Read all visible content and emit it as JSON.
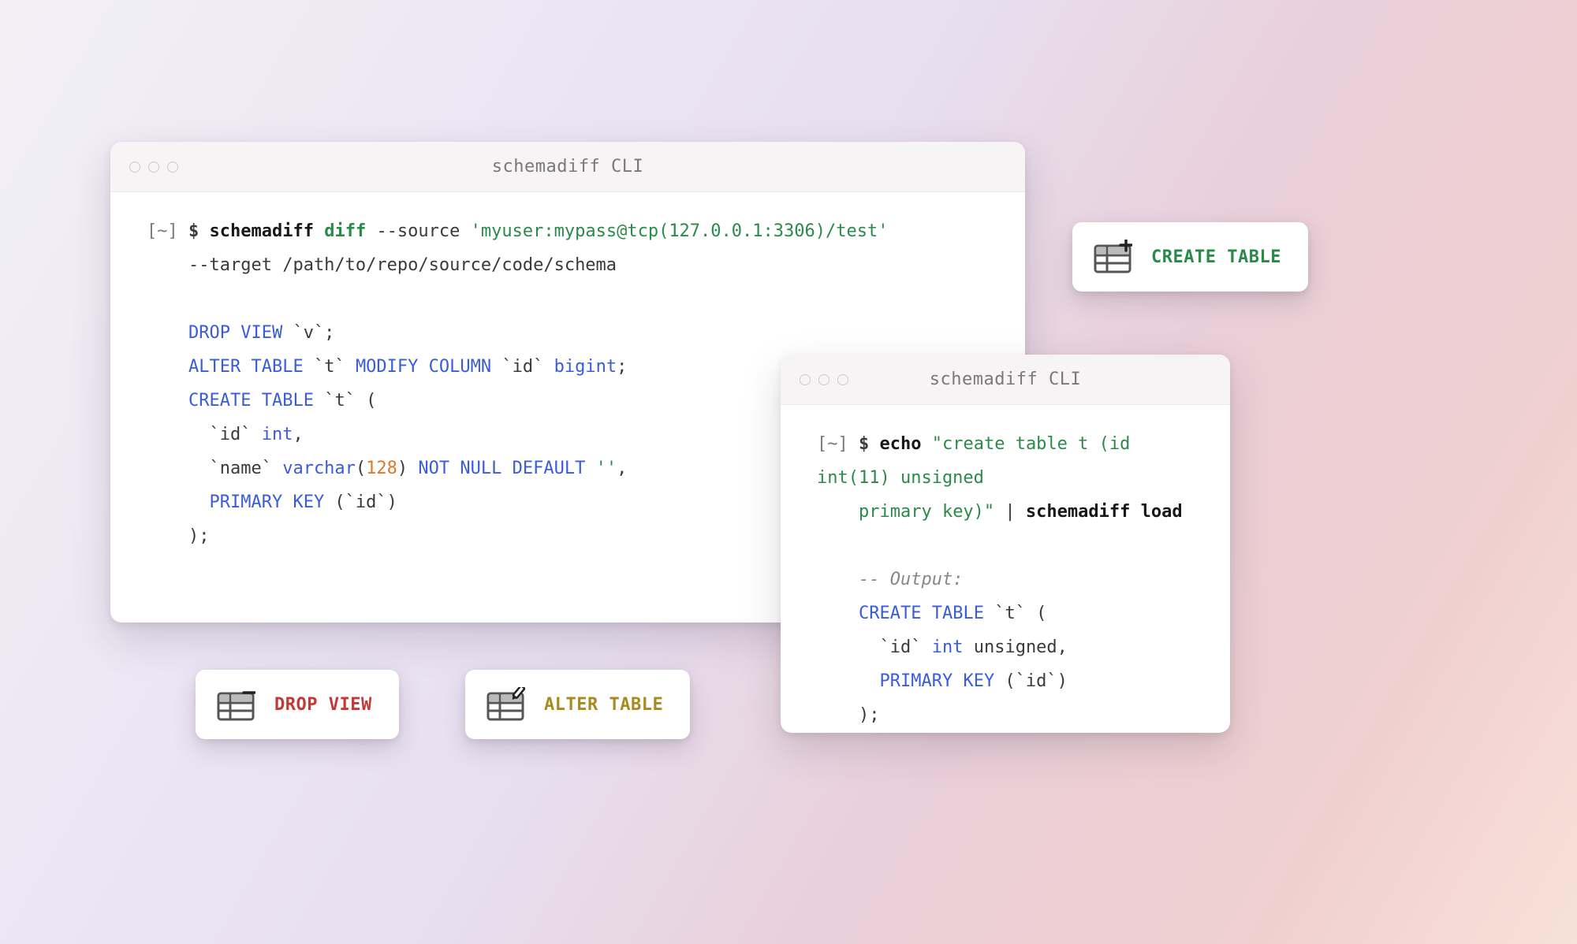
{
  "terminal_left": {
    "title": "schemadiff CLI",
    "prompt": "[~]",
    "dollar": "$",
    "cmd": "schemadiff",
    "subcmd": "diff",
    "flag_source": "--source",
    "source_val": "'myuser:mypass@tcp(127.0.0.1:3306)/test'",
    "flag_target": "--target",
    "target_val": "/path/to/repo/source/code/schema",
    "sql": {
      "l1_a": "DROP",
      "l1_b": " VIEW",
      "l1_c": " `v`;",
      "l2_a": "ALTER",
      "l2_b": " TABLE",
      "l2_c": " `t` ",
      "l2_d": "MODIFY",
      "l2_e": " COLUMN",
      "l2_f": " `id` ",
      "l2_g": "bigint",
      "l2_h": ";",
      "l3_a": "CREATE",
      "l3_b": " TABLE",
      "l3_c": " `t` (",
      "l4_a": "    `id` ",
      "l4_b": "int",
      "l4_c": ",",
      "l5_a": "    `name` ",
      "l5_b": "varchar",
      "l5_c": "(",
      "l5_d": "128",
      "l5_e": ") ",
      "l5_f": "NOT",
      "l5_g": " NULL",
      "l5_h": " DEFAULT",
      "l5_i": " ''",
      "l5_j": ",",
      "l6_a": "    PRIMARY",
      "l6_b": " KEY",
      "l6_c": " (`id`)",
      "l7": ");"
    }
  },
  "terminal_right": {
    "title": "schemadiff CLI",
    "prompt": "[~]",
    "dollar": "$",
    "cmd1": "echo",
    "echo_str_part1": "\"create table t (id int(11) unsigned",
    "echo_str_part2": "primary key)\"",
    "pipe": " | ",
    "cmd2": "schemadiff load",
    "comment": "-- Output:",
    "sql": {
      "l1_a": "CREATE",
      "l1_b": " TABLE",
      "l1_c": " `t` (",
      "l2_a": "    `id` ",
      "l2_b": "int",
      "l2_c": " unsigned,",
      "l3_a": "    PRIMARY",
      "l3_b": " KEY",
      "l3_c": " (`id`)",
      "l4": ");"
    }
  },
  "badges": {
    "create": "CREATE TABLE",
    "drop": "DROP VIEW",
    "alter": "ALTER TABLE"
  },
  "icons": {
    "table_create": "table with plus",
    "table_drop": "table with minus",
    "table_alter": "table with pencil"
  }
}
